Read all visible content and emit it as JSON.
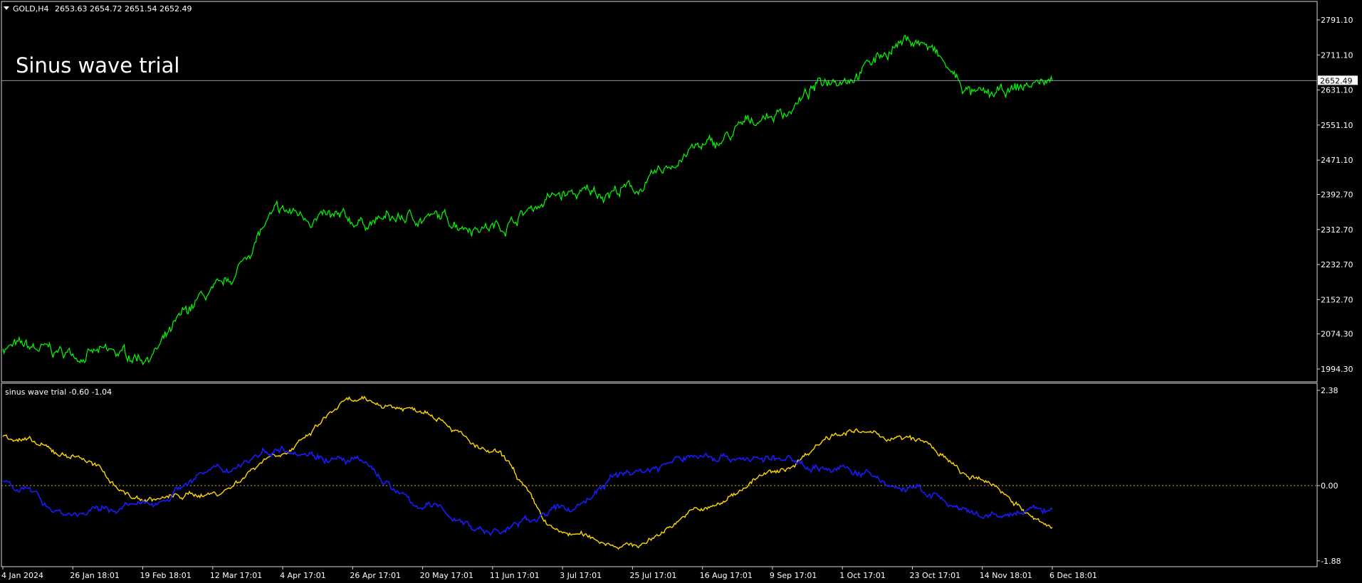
{
  "colors": {
    "background": "#000000",
    "frame": "#d9d9d9",
    "price_series": "#00ff00",
    "current_price_line": "#8f97a6",
    "indicator_yellow": "#ffd700",
    "indicator_blue": "#1a1aff",
    "zero_line": "#d7a72c",
    "text": "#ffffff"
  },
  "main_panel": {
    "header_symbol": "GOLD,H4",
    "header_ohlc": "2653.63 2654.72 2651.54 2652.49",
    "annotation": "Sinus wave trial",
    "current_price_label": "2652.49",
    "price_ticks": [
      "2791.10",
      "2711.10",
      "2631.10",
      "2551.10",
      "2471.10",
      "2392.70",
      "2312.70",
      "2232.70",
      "2152.70",
      "2074.30",
      "1994.30"
    ]
  },
  "indicator_panel": {
    "header": "sinus wave trial -0.60 -1.04",
    "ticks": [
      "2.38",
      "0.00",
      "-1.88"
    ]
  },
  "time_axis": {
    "labels": [
      "4 Jan 2024",
      "26 Jan 18:01",
      "19 Feb 18:01",
      "12 Mar 17:01",
      "4 Apr 17:01",
      "26 Apr 17:01",
      "20 May 17:01",
      "11 Jun 17:01",
      "3 Jul 17:01",
      "25 Jul 17:01",
      "16 Aug 17:01",
      "9 Sep 17:01",
      "1 Oct 17:01",
      "23 Oct 17:01",
      "14 Nov 18:01",
      "6 Dec 18:01"
    ]
  },
  "chart_data": [
    {
      "type": "line",
      "title": "GOLD,H4",
      "x": [
        "4 Jan 2024",
        "26 Jan 18:01",
        "19 Feb 18:01",
        "12 Mar 17:01",
        "4 Apr 17:01",
        "26 Apr 17:01",
        "20 May 17:01",
        "11 Jun 17:01",
        "3 Jul 17:01",
        "25 Jul 17:01",
        "16 Aug 17:01",
        "9 Sep 17:01",
        "1 Oct 17:01",
        "23 Oct 17:01",
        "14 Nov 18:01",
        "6 Dec 18:01"
      ],
      "series": [
        {
          "name": "GOLD,H4",
          "values": [
            2045,
            2030,
            2025,
            2165,
            2350,
            2330,
            2340,
            2320,
            2390,
            2405,
            2500,
            2575,
            2665,
            2745,
            2615,
            2652
          ]
        }
      ],
      "current_value": 2652.49,
      "ylim": [
        1980,
        2820
      ],
      "yticks": [
        2791.1,
        2711.1,
        2631.1,
        2551.1,
        2471.1,
        2392.7,
        2312.7,
        2232.7,
        2152.7,
        2074.3,
        1994.3
      ],
      "grid": false
    },
    {
      "type": "line",
      "title": "sinus wave trial -0.60 -1.04",
      "x": [
        "4 Jan 2024",
        "26 Jan 18:01",
        "19 Feb 18:01",
        "12 Mar 17:01",
        "4 Apr 17:01",
        "26 Apr 17:01",
        "20 May 17:01",
        "11 Jun 17:01",
        "3 Jul 17:01",
        "25 Jul 17:01",
        "16 Aug 17:01",
        "9 Sep 17:01",
        "1 Oct 17:01",
        "23 Oct 17:01",
        "14 Nov 18:01",
        "6 Dec 18:01"
      ],
      "series": [
        {
          "values": [
            1.25,
            0.75,
            -0.35,
            -0.2,
            0.85,
            2.1,
            1.9,
            0.8,
            -1.2,
            -1.5,
            -0.6,
            0.3,
            1.35,
            1.15,
            0.1,
            -1.04
          ],
          "color": "#ffd700"
        },
        {
          "values": [
            0.1,
            -0.7,
            -0.5,
            0.35,
            0.95,
            0.6,
            -0.5,
            -1.15,
            -0.6,
            0.35,
            0.75,
            0.65,
            0.4,
            -0.1,
            -0.8,
            -0.6
          ],
          "color": "#1a1aff"
        }
      ],
      "ylim": [
        -1.88,
        2.38
      ],
      "yticks": [
        2.38,
        0.0,
        -1.88
      ],
      "zero_line": 0.0,
      "grid": false
    }
  ]
}
